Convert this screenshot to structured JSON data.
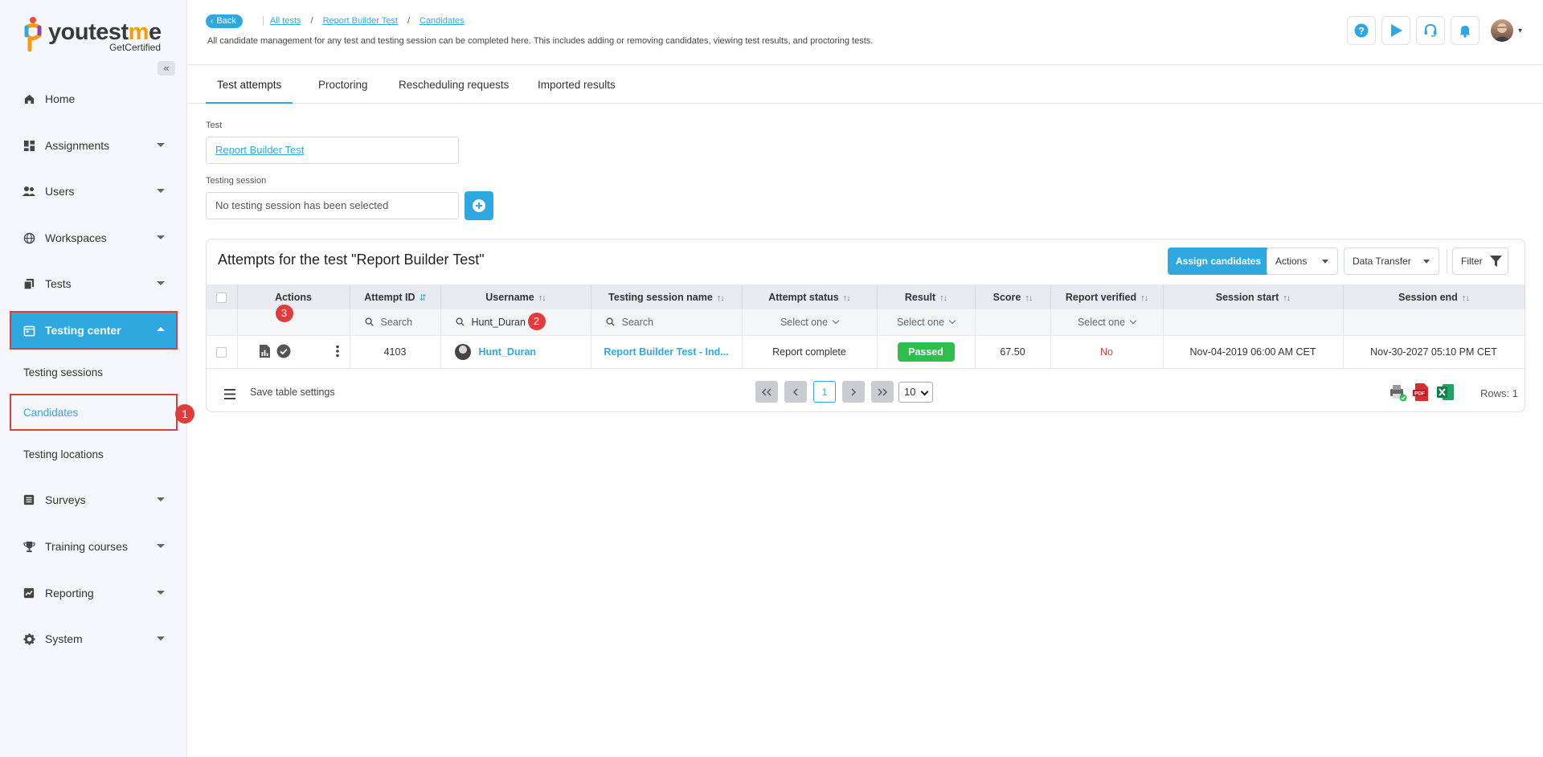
{
  "brand": {
    "name_left": "you",
    "name_test": "test",
    "name_m": "m",
    "name_e": "e",
    "sub": "GetCertified"
  },
  "sidebar": {
    "items": [
      {
        "label": "Home",
        "icon": "home-icon"
      },
      {
        "label": "Assignments",
        "icon": "dashboard-icon"
      },
      {
        "label": "Users",
        "icon": "users-icon"
      },
      {
        "label": "Workspaces",
        "icon": "globe-icon"
      },
      {
        "label": "Tests",
        "icon": "copy-icon"
      },
      {
        "label": "Testing center",
        "icon": "calendar-icon"
      },
      {
        "label": "Surveys",
        "icon": "list-icon"
      },
      {
        "label": "Training courses",
        "icon": "trophy-icon"
      },
      {
        "label": "Reporting",
        "icon": "chart-icon"
      },
      {
        "label": "System",
        "icon": "gear-icon"
      }
    ],
    "sub_items": [
      {
        "label": "Testing sessions"
      },
      {
        "label": "Candidates"
      },
      {
        "label": "Testing locations"
      }
    ]
  },
  "header": {
    "back_label": "Back",
    "breadcrumbs": [
      "All tests",
      "Report Builder Test",
      "Candidates"
    ],
    "breadcrumb_sep": "/",
    "description": "All candidate management for any test and testing session can be completed here. This includes adding or removing candidates, viewing test results, and proctoring tests."
  },
  "tabs": [
    "Test attempts",
    "Proctoring",
    "Rescheduling requests",
    "Imported results"
  ],
  "form": {
    "test_label": "Test",
    "test_value": "Report Builder Test",
    "session_label": "Testing session",
    "session_placeholder": "No testing session has been selected"
  },
  "card": {
    "title": "Attempts for the test \"Report Builder Test\"",
    "assign_label": "Assign candidates",
    "actions_label": "Actions",
    "transfer_label": "Data Transfer",
    "filter_label": "Filter"
  },
  "table": {
    "columns": [
      "Actions",
      "Attempt ID",
      "Username",
      "Testing session name",
      "Attempt status",
      "Result",
      "Score",
      "Report verified",
      "Session start",
      "Session end"
    ],
    "filters": {
      "search": "Search",
      "username": "Hunt_Duran",
      "select_one": "Select one"
    },
    "rows": [
      {
        "attempt_id": "4103",
        "username": "Hunt_Duran",
        "session": "Report Builder Test - Ind...",
        "status": "Report complete",
        "result": "Passed",
        "score": "67.50",
        "verified": "No",
        "start": "Nov-04-2019 06:00 AM CET",
        "end": "Nov-30-2027 05:10 PM CET"
      }
    ]
  },
  "footer": {
    "save_settings": "Save table settings",
    "page": "1",
    "page_size": "10",
    "rows_label": "Rows: 1"
  },
  "badges": [
    "1",
    "2",
    "3"
  ],
  "colors": {
    "accent": "#2fa8e0",
    "highlight": "#e03c3c",
    "success": "#2fbd4c"
  }
}
